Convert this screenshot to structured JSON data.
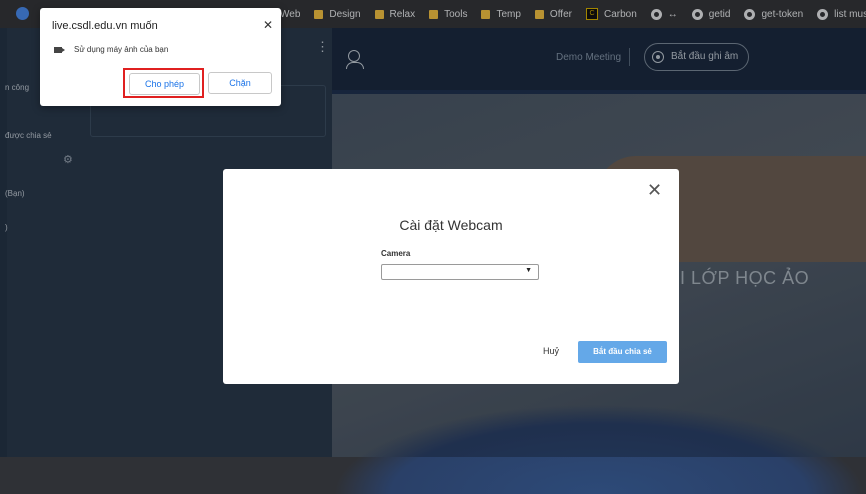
{
  "bookmarks": {
    "items": [
      {
        "label": "Web",
        "icon": "folder-icon"
      },
      {
        "label": "Design",
        "icon": "folder-icon"
      },
      {
        "label": "Relax",
        "icon": "folder-icon"
      },
      {
        "label": "Tools",
        "icon": "folder-icon"
      },
      {
        "label": "Temp",
        "icon": "folder-icon"
      },
      {
        "label": "Offer",
        "icon": "folder-icon"
      },
      {
        "label": "Carbon",
        "icon": "carbon-icon"
      },
      {
        "label": "↔",
        "icon": "globe-icon"
      },
      {
        "label": "getid",
        "icon": "globe-icon"
      },
      {
        "label": "get-token",
        "icon": "globe-icon"
      },
      {
        "label": "list music",
        "icon": "globe-icon"
      }
    ]
  },
  "left_panel": {
    "text_1": "n công",
    "text_2": "được chia sẻ",
    "text_3": "(Bạn)",
    "text_4": ")"
  },
  "meeting": {
    "title": "Demo Meeting",
    "record_label": "Bắt đầu ghi âm",
    "banner_text": "I LỚP HỌC ẢO"
  },
  "modal": {
    "title": "Cài đặt Webcam",
    "camera_label": "Camera",
    "camera_value": "",
    "cancel_label": "Huỷ",
    "start_label": "Bắt đầu chia sẻ"
  },
  "permission": {
    "title": "live.csdl.edu.vn muốn",
    "description": "Sử dụng máy ảnh của bạn",
    "allow_label": "Cho phép",
    "block_label": "Chặn"
  },
  "colors": {
    "primary_button": "#64a8e8",
    "highlight_border": "#e02020",
    "link_blue": "#1a73e8"
  }
}
